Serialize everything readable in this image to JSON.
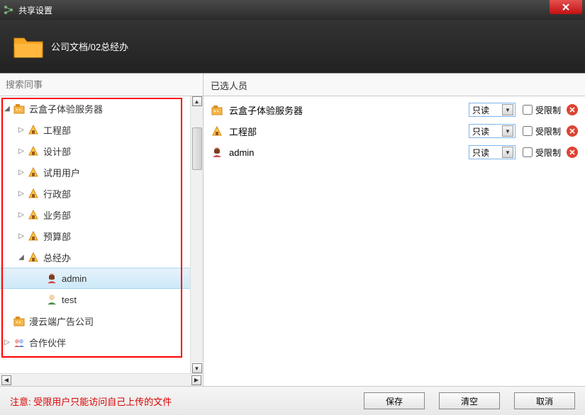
{
  "window": {
    "title": "共享设置"
  },
  "header": {
    "breadcrumb": "公司文档/02总经办"
  },
  "left": {
    "search_placeholder": "搜索同事",
    "tree": [
      {
        "label": "云盒子体验服务器",
        "depth": 0,
        "icon": "org",
        "expanded": true,
        "selected": false
      },
      {
        "label": "工程部",
        "depth": 1,
        "icon": "dept",
        "expanded": false,
        "selected": false
      },
      {
        "label": "设计部",
        "depth": 1,
        "icon": "dept",
        "expanded": false,
        "selected": false
      },
      {
        "label": "试用用户",
        "depth": 1,
        "icon": "dept",
        "expanded": false,
        "selected": false
      },
      {
        "label": "行政部",
        "depth": 1,
        "icon": "dept",
        "expanded": false,
        "selected": false
      },
      {
        "label": "业务部",
        "depth": 1,
        "icon": "dept",
        "expanded": false,
        "selected": false
      },
      {
        "label": "预算部",
        "depth": 1,
        "icon": "dept",
        "expanded": false,
        "selected": false
      },
      {
        "label": "总经办",
        "depth": 1,
        "icon": "dept",
        "expanded": true,
        "selected": false
      },
      {
        "label": "admin",
        "depth": 2,
        "icon": "user-f",
        "expanded": null,
        "selected": true
      },
      {
        "label": "test",
        "depth": 2,
        "icon": "user-m",
        "expanded": null,
        "selected": false
      },
      {
        "label": "漫云端广告公司",
        "depth": 0,
        "icon": "org",
        "expanded": null,
        "selected": false
      },
      {
        "label": "合作伙伴",
        "depth": 0,
        "icon": "partners",
        "expanded": false,
        "selected": false
      }
    ]
  },
  "right": {
    "header": "已选人员",
    "perm_option": "只读",
    "restrict_label": "受限制",
    "members": [
      {
        "name": "云盒子体验服务器",
        "icon": "org"
      },
      {
        "name": "工程部",
        "icon": "dept"
      },
      {
        "name": "admin",
        "icon": "user-f"
      }
    ]
  },
  "footer": {
    "warning": "注意: 受限用户只能访问自己上传的文件",
    "save": "保存",
    "clear": "清空",
    "cancel": "取消"
  }
}
